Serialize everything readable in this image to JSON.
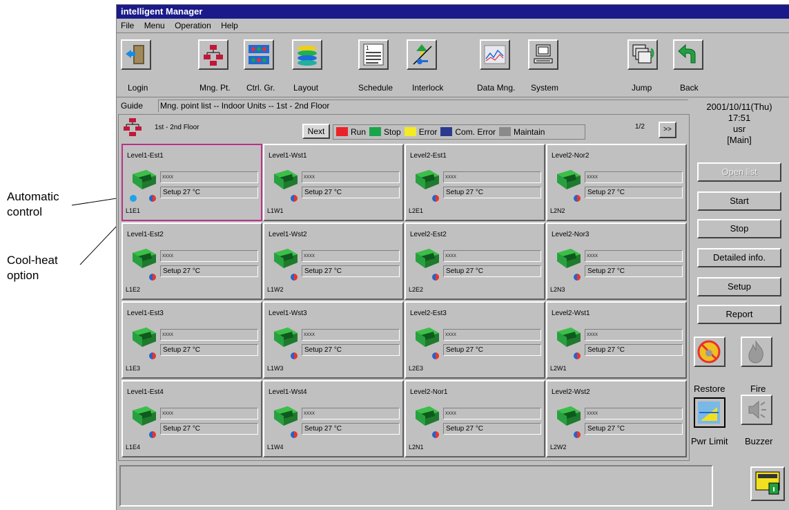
{
  "annotations": {
    "automatic_control": [
      "Automatic",
      "control"
    ],
    "cool_heat_option": [
      "Cool-heat",
      "option"
    ]
  },
  "window": {
    "title": "intelligent Manager"
  },
  "menu": [
    "File",
    "Menu",
    "Operation",
    "Help"
  ],
  "toolbar": {
    "login": "Login",
    "mng_pt": "Mng. Pt.",
    "ctrl_gr": "Ctrl. Gr.",
    "layout": "Layout",
    "schedule": "Schedule",
    "interlock": "Interlock",
    "data_mng": "Data Mng.",
    "system": "System",
    "jump": "Jump",
    "back": "Back"
  },
  "guide": {
    "label": "Guide",
    "text": "Mng. point list -- Indoor Units -- 1st - 2nd Floor"
  },
  "panel": {
    "floor": "1st - 2nd Floor",
    "next": "Next",
    "page": "1/2",
    "more": ">>",
    "legend": [
      {
        "label": "Run",
        "color": "#e8242a"
      },
      {
        "label": "Stop",
        "color": "#1aa54a"
      },
      {
        "label": "Error",
        "color": "#f4ea26"
      },
      {
        "label": "Com. Error",
        "color": "#2b3a8f"
      },
      {
        "label": "Maintain",
        "color": "#8a8a8a"
      }
    ]
  },
  "units": [
    {
      "name": "Level1-Est1",
      "field": "xxxx",
      "setup": "Setup 27 °C",
      "code": "L1E1"
    },
    {
      "name": "Level1-Wst1",
      "field": "xxxx",
      "setup": "Setup 27 °C",
      "code": "L1W1"
    },
    {
      "name": "Level2-Est1",
      "field": "xxxx",
      "setup": "Setup 27 °C",
      "code": "L2E1"
    },
    {
      "name": "Level2-Nor2",
      "field": "xxxx",
      "setup": "Setup 27 °C",
      "code": "L2N2"
    },
    {
      "name": "Level1-Est2",
      "field": "xxxx",
      "setup": "Setup 27 °C",
      "code": "L1E2"
    },
    {
      "name": "Level1-Wst2",
      "field": "xxxx",
      "setup": "Setup 27 °C",
      "code": "L1W2"
    },
    {
      "name": "Level2-Est2",
      "field": "xxxx",
      "setup": "Setup 27 °C",
      "code": "L2E2"
    },
    {
      "name": "Level2-Nor3",
      "field": "xxxx",
      "setup": "Setup 27 °C",
      "code": "L2N3"
    },
    {
      "name": "Level1-Est3",
      "field": "xxxx",
      "setup": "Setup 27 °C",
      "code": "L1E3"
    },
    {
      "name": "Level1-Wst3",
      "field": "xxxx",
      "setup": "Setup 27 °C",
      "code": "L1W3"
    },
    {
      "name": "Level2-Est3",
      "field": "xxxx",
      "setup": "Setup 27 °C",
      "code": "L2E3"
    },
    {
      "name": "Level2-Wst1",
      "field": "xxxx",
      "setup": "Setup 27 °C",
      "code": "L2W1"
    },
    {
      "name": "Level1-Est4",
      "field": "xxxx",
      "setup": "Setup 27 °C",
      "code": "L1E4"
    },
    {
      "name": "Level1-Wst4",
      "field": "xxxx",
      "setup": "Setup 27 °C",
      "code": "L1W4"
    },
    {
      "name": "Level2-Nor1",
      "field": "xxxx",
      "setup": "Setup 27 °C",
      "code": "L2N1"
    },
    {
      "name": "Level2-Wst2",
      "field": "xxxx",
      "setup": "Setup 27 °C",
      "code": "L2W2"
    }
  ],
  "right": {
    "date": "2001/10/11(Thu)",
    "time": "17:51",
    "user": "usr",
    "role": "[Main]",
    "buttons": [
      "Open list",
      "Start",
      "Stop",
      "Detailed info.",
      "Setup",
      "Report"
    ],
    "restore": "Restore",
    "fire": "Fire",
    "pwr_limit": "Pwr Limit",
    "buzzer": "Buzzer"
  },
  "icons": {
    "login": "door-arrow-icon",
    "mng_pt": "hierarchy-icon",
    "ctrl_gr": "group-cards-icon",
    "layout": "layers-icon",
    "schedule": "calendar-icon",
    "interlock": "interlock-icon",
    "data_mng": "chart-icon",
    "system": "computer-icon",
    "jump": "windows-icon",
    "back": "back-arrow-icon"
  }
}
